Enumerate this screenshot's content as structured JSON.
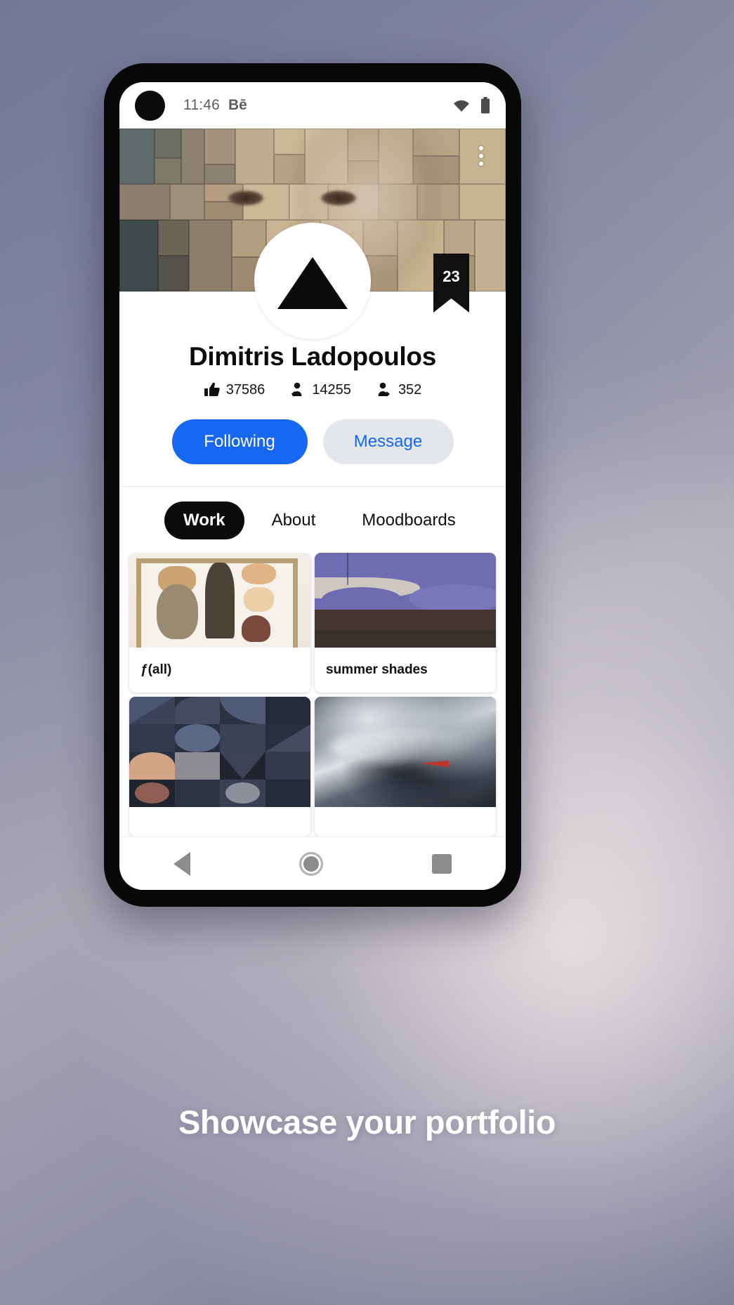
{
  "statusbar": {
    "time": "11:46",
    "app_badge": "Bē",
    "wifi_icon": "wifi-icon",
    "battery_icon": "battery-icon"
  },
  "cover": {
    "menu_icon": "overflow-menu-icon",
    "alt": "mosaic portrait cover photo"
  },
  "profile": {
    "avatar_icon": "triangle-avatar-icon",
    "ribbon_badge": "23",
    "name": "Dimitris Ladopoulos",
    "stats": [
      {
        "icon": "thumbs-up-icon",
        "value": "37586"
      },
      {
        "icon": "followers-icon",
        "value": "14255"
      },
      {
        "icon": "following-icon",
        "value": "352"
      }
    ],
    "actions": {
      "following_label": "Following",
      "message_label": "Message",
      "following_color": "#1667f2",
      "message_bg": "#e3e6eb"
    }
  },
  "tabs": [
    {
      "label": "Work",
      "active": true
    },
    {
      "label": "About",
      "active": false
    },
    {
      "label": "Moodboards",
      "active": false
    }
  ],
  "projects": [
    {
      "title": "ƒ(all)"
    },
    {
      "title": "summer shades"
    },
    {
      "title": ""
    },
    {
      "title": ""
    }
  ],
  "navbar": {
    "back_icon": "back-triangle-icon",
    "home_icon": "home-circle-icon",
    "recents_icon": "recents-square-icon"
  },
  "caption": "Showcase your portfolio"
}
